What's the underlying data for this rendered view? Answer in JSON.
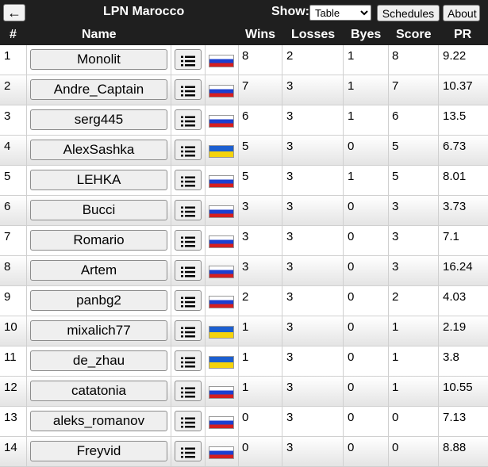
{
  "header": {
    "back_label": "←",
    "title": "LPN Marocco",
    "show_label": "Show:",
    "show_selected": "Table",
    "schedules_label": "Schedules",
    "about_label": "About"
  },
  "columns": {
    "num": "#",
    "name": "Name",
    "wins": "Wins",
    "losses": "Losses",
    "byes": "Byes",
    "score": "Score",
    "pr": "PR"
  },
  "colors": {
    "header_bg": "#1f1f1f",
    "flag_ru": [
      "#ffffff",
      "#1c3fd0",
      "#d51f1f"
    ],
    "flag_ua": [
      "#1c5fd0",
      "#f5d30c"
    ]
  },
  "rows": [
    {
      "num": "1",
      "name": "Monolit",
      "flag": "ru",
      "wins": "8",
      "losses": "2",
      "byes": "1",
      "score": "8",
      "pr": "9.22"
    },
    {
      "num": "2",
      "name": "Andre_Captain",
      "flag": "ru",
      "wins": "7",
      "losses": "3",
      "byes": "1",
      "score": "7",
      "pr": "10.37"
    },
    {
      "num": "3",
      "name": "serg445",
      "flag": "ru",
      "wins": "6",
      "losses": "3",
      "byes": "1",
      "score": "6",
      "pr": "13.5"
    },
    {
      "num": "4",
      "name": "AlexSashka",
      "flag": "ua",
      "wins": "5",
      "losses": "3",
      "byes": "0",
      "score": "5",
      "pr": "6.73"
    },
    {
      "num": "5",
      "name": "LEHKA",
      "flag": "ru",
      "wins": "5",
      "losses": "3",
      "byes": "1",
      "score": "5",
      "pr": "8.01"
    },
    {
      "num": "6",
      "name": "Bucci",
      "flag": "ru",
      "wins": "3",
      "losses": "3",
      "byes": "0",
      "score": "3",
      "pr": "3.73"
    },
    {
      "num": "7",
      "name": "Romario",
      "flag": "ru",
      "wins": "3",
      "losses": "3",
      "byes": "0",
      "score": "3",
      "pr": "7.1"
    },
    {
      "num": "8",
      "name": "Artem",
      "flag": "ru",
      "wins": "3",
      "losses": "3",
      "byes": "0",
      "score": "3",
      "pr": "16.24"
    },
    {
      "num": "9",
      "name": "panbg2",
      "flag": "ru",
      "wins": "2",
      "losses": "3",
      "byes": "0",
      "score": "2",
      "pr": "4.03"
    },
    {
      "num": "10",
      "name": "mixalich77",
      "flag": "ua",
      "wins": "1",
      "losses": "3",
      "byes": "0",
      "score": "1",
      "pr": "2.19"
    },
    {
      "num": "11",
      "name": "de_zhau",
      "flag": "ua",
      "wins": "1",
      "losses": "3",
      "byes": "0",
      "score": "1",
      "pr": "3.8"
    },
    {
      "num": "12",
      "name": "catatonia",
      "flag": "ru",
      "wins": "1",
      "losses": "3",
      "byes": "0",
      "score": "1",
      "pr": "10.55"
    },
    {
      "num": "13",
      "name": "aleks_romanov",
      "flag": "ru",
      "wins": "0",
      "losses": "3",
      "byes": "0",
      "score": "0",
      "pr": "7.13"
    },
    {
      "num": "14",
      "name": "Freyvid",
      "flag": "ru",
      "wins": "0",
      "losses": "3",
      "byes": "0",
      "score": "0",
      "pr": "8.88"
    }
  ]
}
